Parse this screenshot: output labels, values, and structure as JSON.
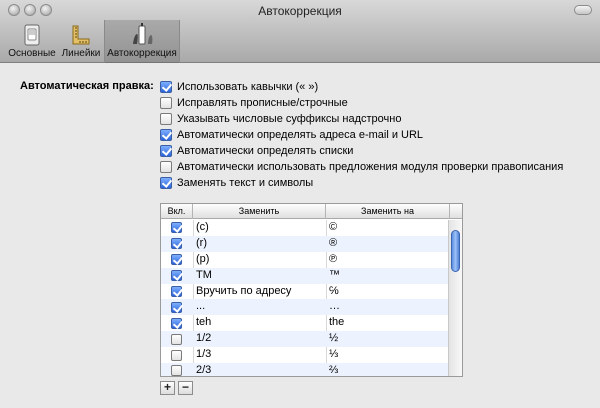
{
  "window": {
    "title": "Автокоррекция"
  },
  "toolbar": {
    "items": [
      {
        "label": "Основные",
        "icon": "switch-icon"
      },
      {
        "label": "Линейки",
        "icon": "ruler-icon"
      },
      {
        "label": "Автокоррекция",
        "icon": "autocorrect-icon"
      }
    ],
    "selected": "Автокоррекция"
  },
  "auto_correction": {
    "label": "Автоматическая правка:",
    "options": [
      {
        "label": "Использовать кавычки (« »)",
        "checked": true
      },
      {
        "label": "Исправлять прописные/строчные",
        "checked": false
      },
      {
        "label": "Указывать числовые суффиксы надстрочно",
        "checked": false
      },
      {
        "label": "Автоматически определять адреса e-mail и URL",
        "checked": true
      },
      {
        "label": "Автоматически определять списки",
        "checked": true
      },
      {
        "label": "Автоматически использовать предложения модуля проверки правописания",
        "checked": false
      },
      {
        "label": "Заменять текст и символы",
        "checked": true
      }
    ]
  },
  "replace_table": {
    "headers": {
      "enabled": "Вкл.",
      "replace": "Заменить",
      "with": "Заменить на"
    },
    "rows": [
      {
        "on": true,
        "replace": "(c)",
        "with": "©"
      },
      {
        "on": true,
        "replace": "(r)",
        "with": "®"
      },
      {
        "on": true,
        "replace": "(p)",
        "with": "℗"
      },
      {
        "on": true,
        "replace": "TM",
        "with": "™"
      },
      {
        "on": true,
        "replace": "Вручить по адресу",
        "with": "℅"
      },
      {
        "on": true,
        "replace": "...",
        "with": "…"
      },
      {
        "on": true,
        "replace": "teh",
        "with": "the"
      },
      {
        "on": false,
        "replace": "1/2",
        "with": "½"
      },
      {
        "on": false,
        "replace": "1/3",
        "with": "⅓"
      },
      {
        "on": false,
        "replace": "2/3",
        "with": "⅔"
      }
    ]
  },
  "buttons": {
    "add": "+",
    "remove": "−"
  },
  "colors": {
    "accent": "#2b65d9",
    "row_alt": "#edf3fe"
  }
}
